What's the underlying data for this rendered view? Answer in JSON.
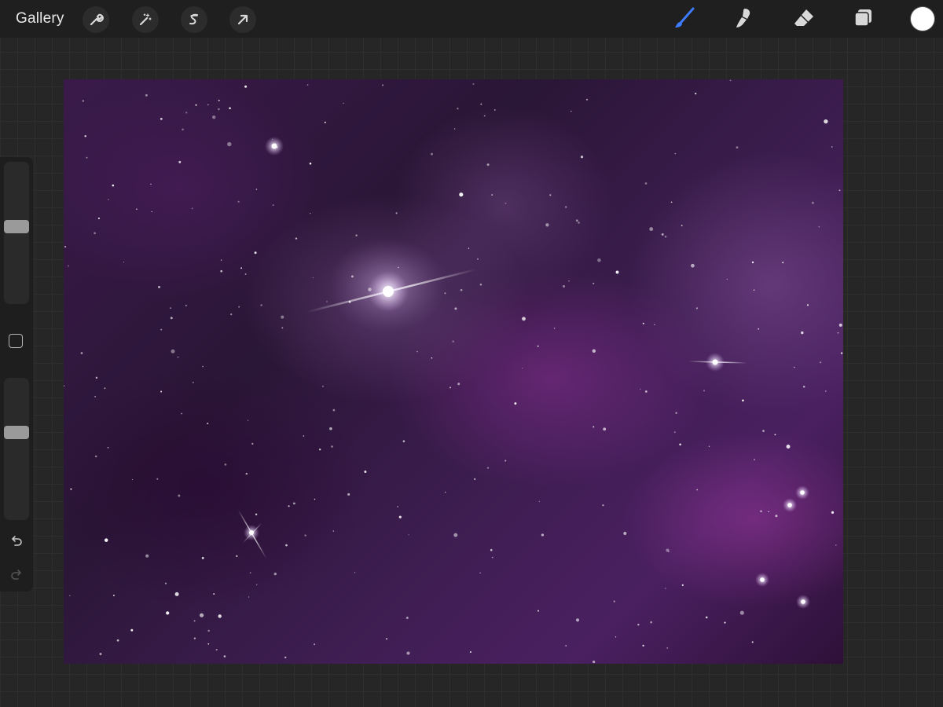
{
  "toolbar": {
    "gallery_label": "Gallery",
    "left_tools": [
      "wrench-icon",
      "magic-wand-icon",
      "selection-icon",
      "transform-arrow-icon"
    ],
    "right_tools": [
      "brush-icon",
      "smudge-icon",
      "eraser-icon",
      "layers-icon"
    ],
    "active_tool": "brush-icon",
    "active_color": "#3d7bff",
    "current_color": "#ffffff"
  },
  "sidebar": {
    "brush_size_level": 0.55,
    "opacity_level": 0.63,
    "undo_icon": "undo-icon",
    "redo_icon": "redo-icon",
    "modify_icon": "square-icon"
  },
  "canvas": {
    "content": "painting"
  }
}
